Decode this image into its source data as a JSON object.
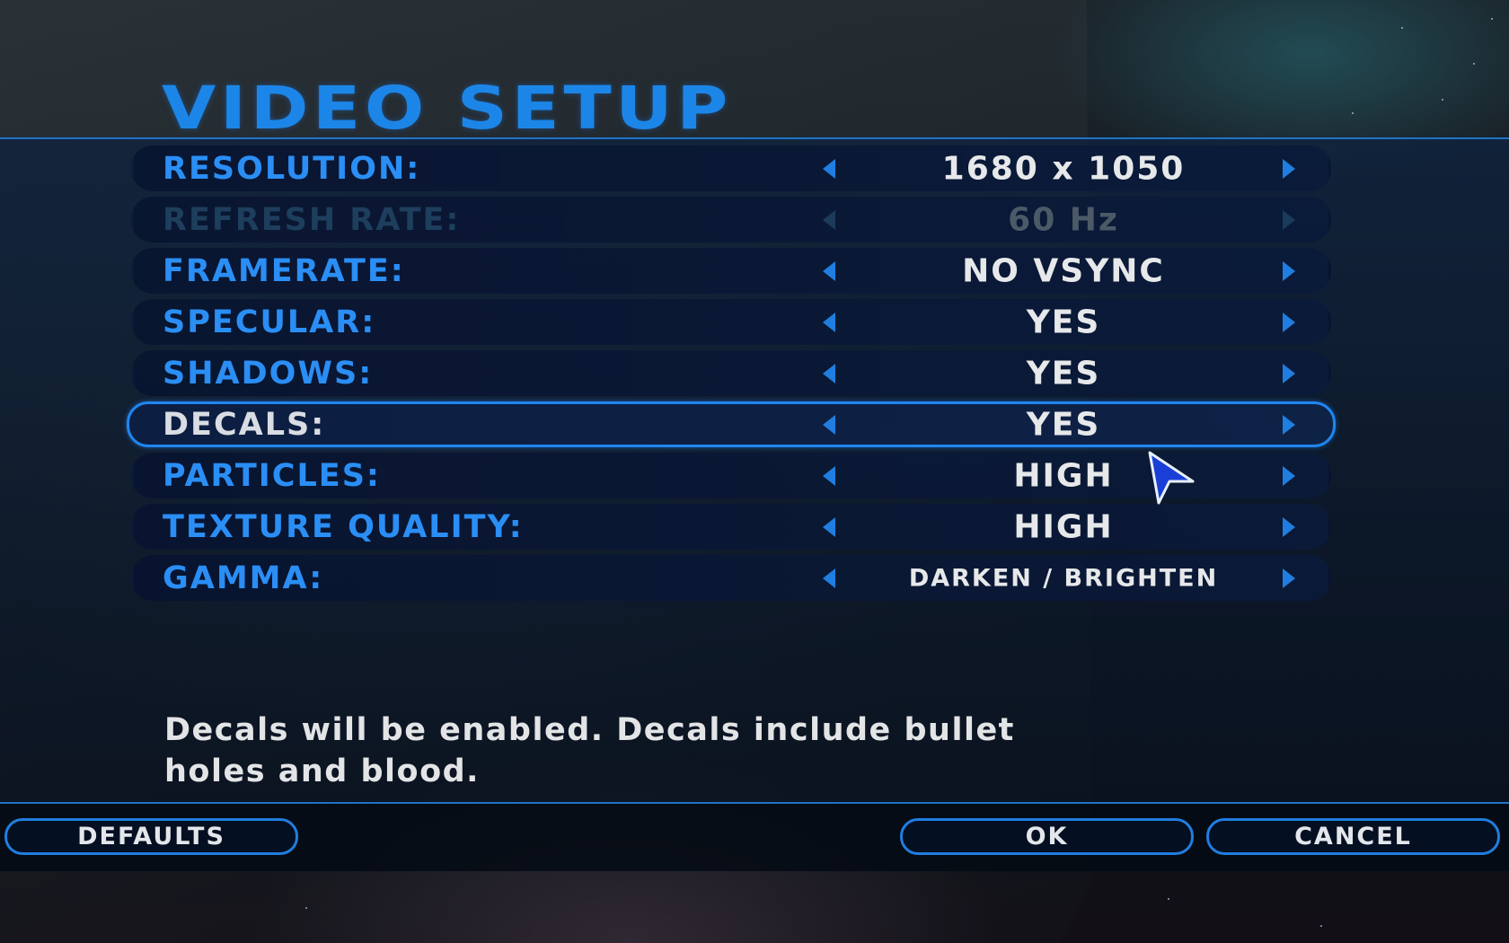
{
  "title": "VIDEO SETUP",
  "settings": [
    {
      "label": "RESOLUTION:",
      "value": "1680 x 1050",
      "state": "normal"
    },
    {
      "label": "REFRESH RATE:",
      "value": "60 Hz",
      "state": "disabled"
    },
    {
      "label": "FRAMERATE:",
      "value": "NO VSYNC",
      "state": "normal"
    },
    {
      "label": "SPECULAR:",
      "value": "YES",
      "state": "normal"
    },
    {
      "label": "SHADOWS:",
      "value": "YES",
      "state": "normal"
    },
    {
      "label": "DECALS:",
      "value": "YES",
      "state": "selected"
    },
    {
      "label": "PARTICLES:",
      "value": "HIGH",
      "state": "normal"
    },
    {
      "label": "TEXTURE QUALITY:",
      "value": "HIGH",
      "state": "normal"
    },
    {
      "label": "GAMMA:",
      "value": "DARKEN / BRIGHTEN",
      "state": "normal"
    }
  ],
  "description": {
    "line1": "Decals will be enabled.  Decals include bullet",
    "line2": "holes and blood."
  },
  "buttons": {
    "defaults": "DEFAULTS",
    "ok": "OK",
    "cancel": "CANCEL"
  },
  "icons": {
    "left_arrow": "left-arrow-icon",
    "right_arrow": "right-arrow-icon",
    "cursor": "pointer-cursor-icon"
  },
  "colors": {
    "accent": "#1f7ee0",
    "label": "#2a8ef5",
    "value": "#e6e8ea"
  }
}
